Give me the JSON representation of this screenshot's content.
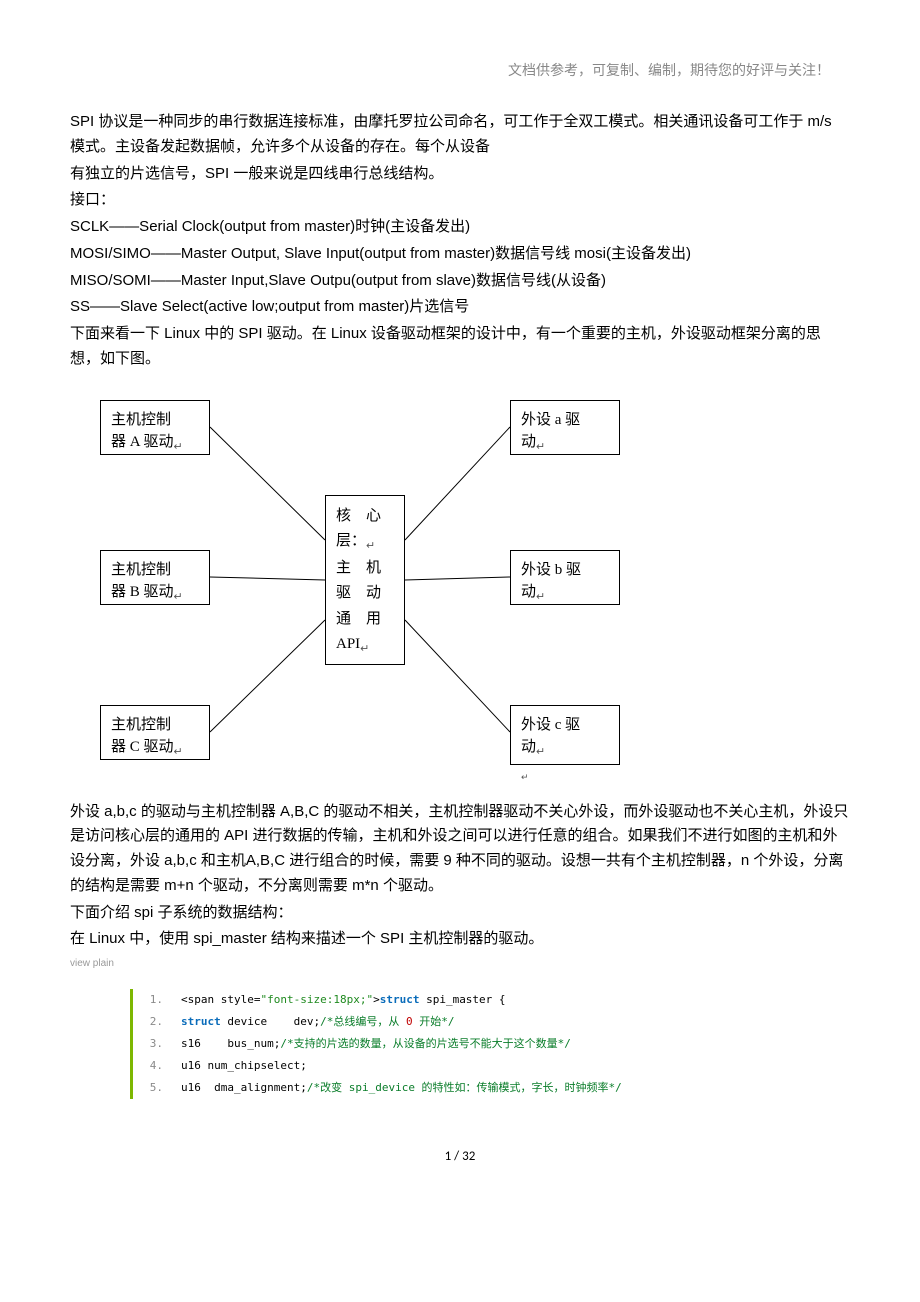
{
  "headerNote": "文档供参考，可复制、编制，期待您的好评与关注！",
  "paragraphs": [
    "SPI 协议是一种同步的串行数据连接标准，由摩托罗拉公司命名，可工作于全双工模式。相关通讯设备可工作于 m/s 模式。主设备发起数据帧，允许多个从设备的存在。每个从设备",
    "有独立的片选信号，SPI 一般来说是四线串行总线结构。",
    "接口：",
    "SCLK——Serial Clock(output from master)时钟(主设备发出)",
    "MOSI/SIMO——Master Output, Slave Input(output from master)数据信号线 mosi(主设备发出)",
    "MISO/SOMI——Master Input,Slave Outpu(output from slave)数据信号线(从设备)",
    "SS——Slave Select(active low;output from master)片选信号",
    "下面来看一下 Linux 中的 SPI 驱动。在 Linux 设备驱动框架的设计中，有一个重要的主机，外设驱动框架分离的思想，如下图。"
  ],
  "diagram": {
    "left1": "主机控制器 A 驱动",
    "left2": "主机控制器 B 驱动",
    "left3": "主机控制器 C 驱动",
    "right1": "外设 a 驱动",
    "right2": "外设 b 驱动",
    "right3": "外设 c 驱动",
    "center": "核 心层：\n主 机驱 动通 用API"
  },
  "afterDiagram": [
    "外设 a,b,c 的驱动与主机控制器 A,B,C 的驱动不相关，主机控制器驱动不关心外设，而外设驱动也不关心主机，外设只是访问核心层的通用的 API 进行数据的传输，主机和外设之间可以进行任意的组合。如果我们不进行如图的主机和外设分离，外设 a,b,c 和主机A,B,C 进行组合的时候，需要 9 种不同的驱动。设想一共有个主机控制器，n 个外设，分离的结构是需要 m+n 个驱动，不分离则需要 m*n 个驱动。",
    "下面介绍 spi 子系统的数据结构：",
    "在 Linux 中，使用 spi_master 结构来描述一个 SPI 主机控制器的驱动。"
  ],
  "viewPlain": "view plain",
  "code": [
    {
      "raw": "<span style=\"font-size:18px;\">struct spi_master {"
    },
    {
      "raw": "struct device    dev;/*总线编号，从 0 开始*/"
    },
    {
      "raw": "s16    bus_num;/*支持的片选的数量，从设备的片选号不能大于这个数量*/"
    },
    {
      "raw": "u16 num_chipselect;"
    },
    {
      "raw": "u16  dma_alignment;/*改变 spi_device 的特性如：传输模式，字长，时钟频率*/"
    }
  ],
  "footer": "1 / 32"
}
